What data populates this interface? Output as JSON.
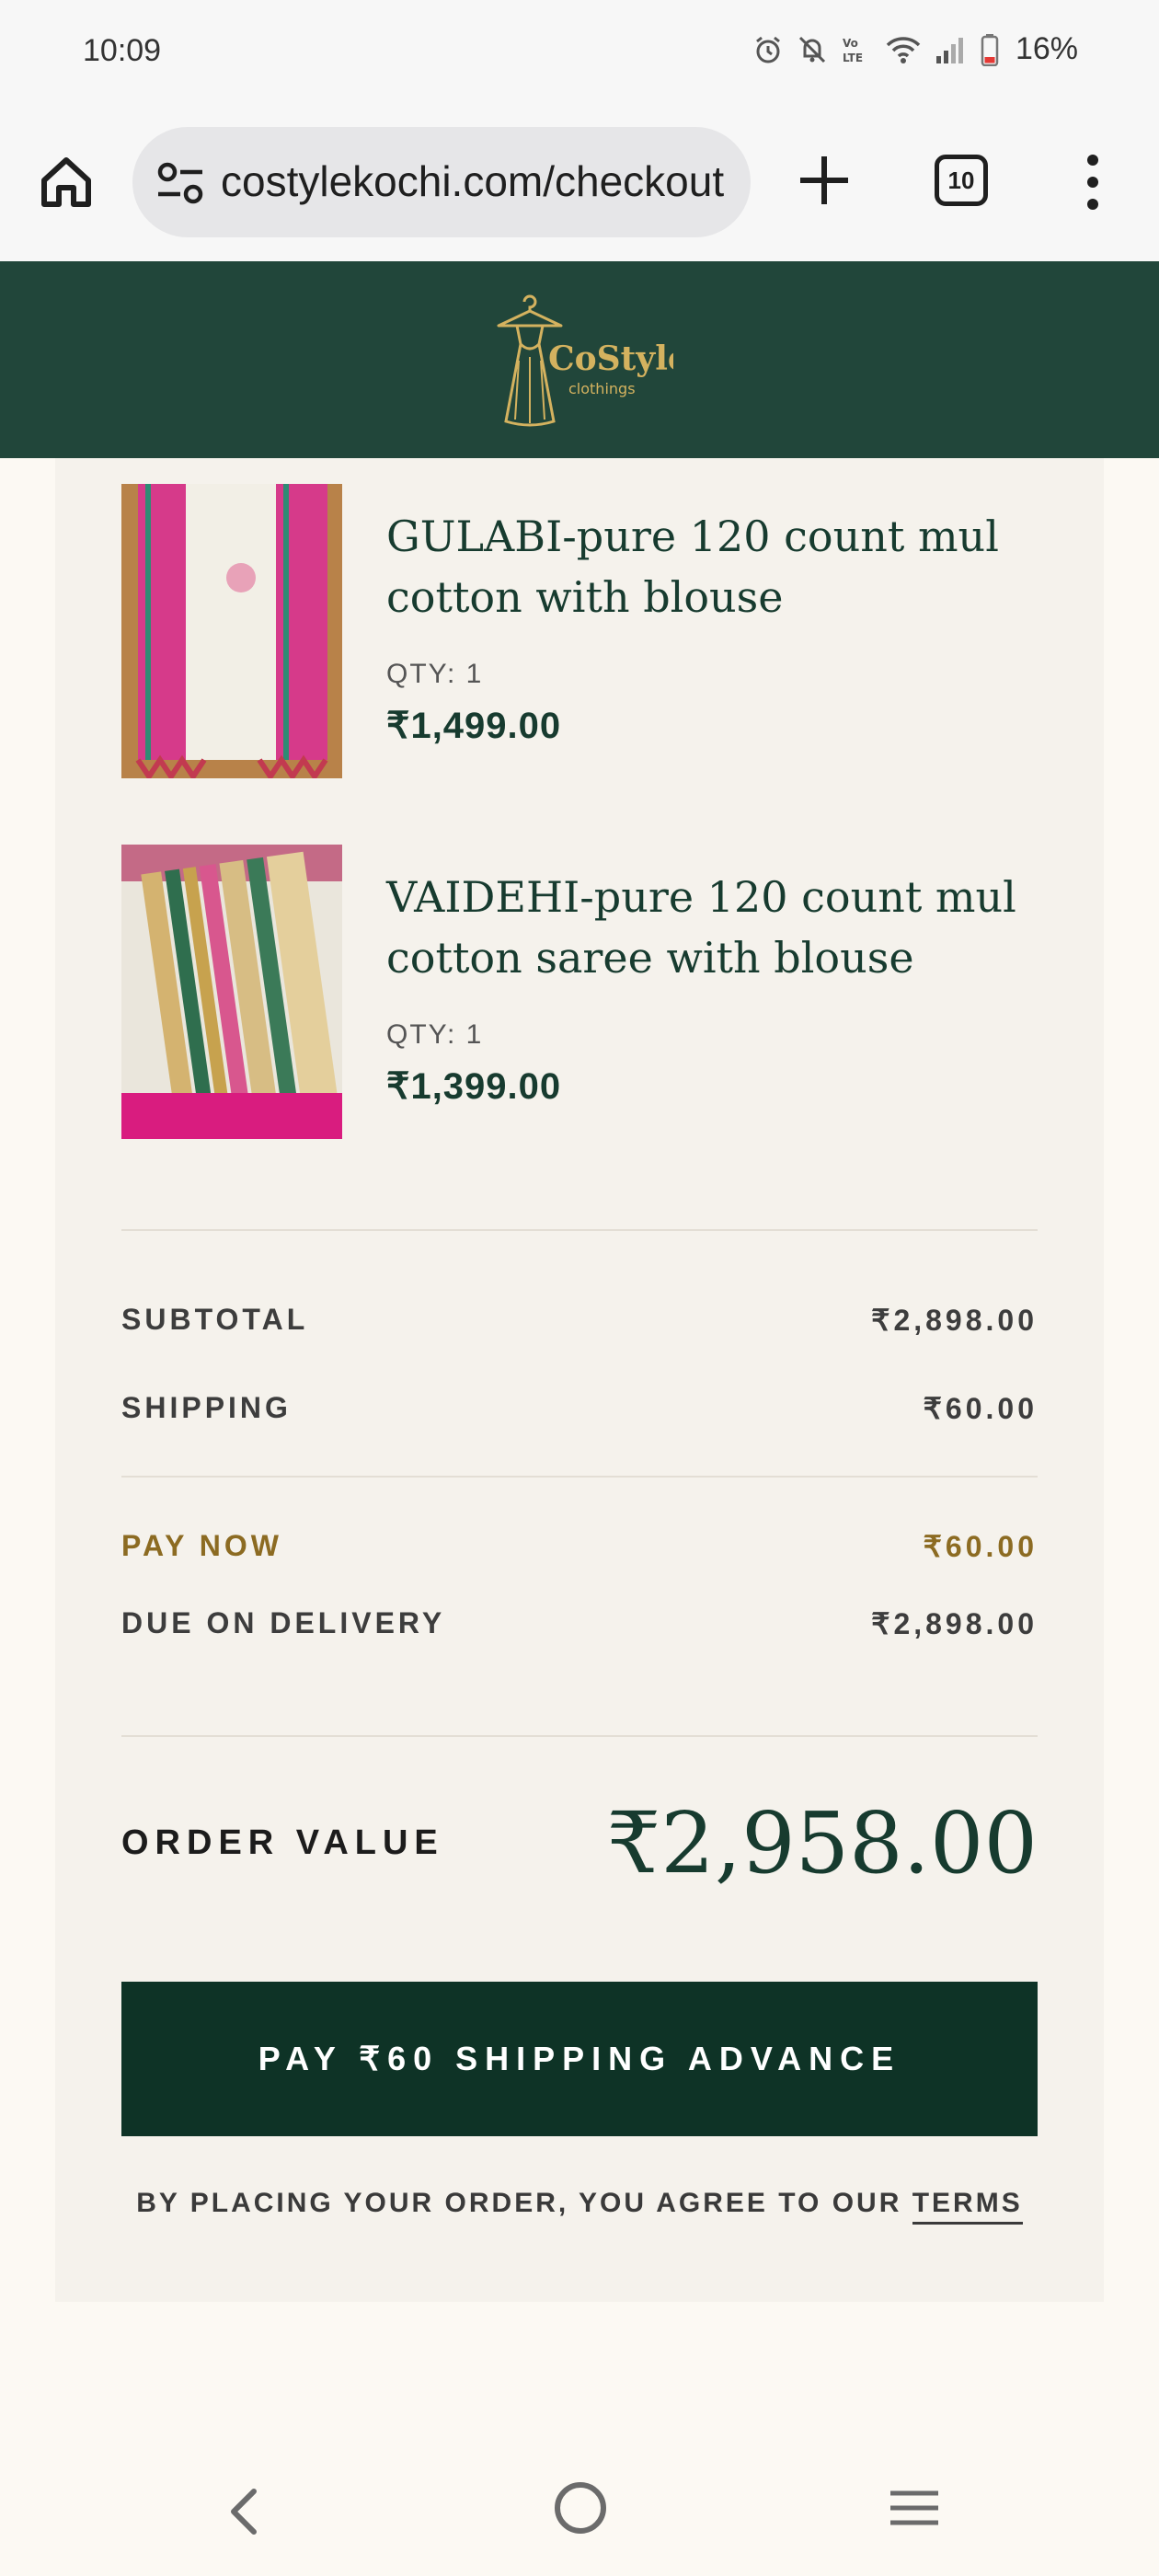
{
  "status_bar": {
    "time": "10:09",
    "battery": "16%",
    "icons": [
      "alarm-icon",
      "mute-icon",
      "volte-icon",
      "wifi-icon",
      "signal-icon",
      "battery-icon"
    ]
  },
  "browser": {
    "url": "costylekochi.com/checkout",
    "tab_count": "10",
    "icons": [
      "home-icon",
      "tune-icon",
      "plus-icon",
      "more-vert-icon"
    ]
  },
  "header": {
    "brand_name": "CoStyle",
    "brand_tagline": "clothings"
  },
  "cart": {
    "items": [
      {
        "name": "GULABI-pure 120 count mul cotton with blouse",
        "qty": "QTY: 1",
        "price": "₹1,499.00"
      },
      {
        "name": "VAIDEHI-pure 120 count mul cotton saree with blouse",
        "qty": "QTY: 1",
        "price": "₹1,399.00"
      }
    ]
  },
  "summary": {
    "subtotal_label": "SUBTOTAL",
    "subtotal_value": "₹2,898.00",
    "shipping_label": "SHIPPING",
    "shipping_value": "₹60.00",
    "pay_now_label": "PAY NOW",
    "pay_now_value": "₹60.00",
    "due_label": "DUE ON DELIVERY",
    "due_value": "₹2,898.00",
    "order_value_label": "ORDER VALUE",
    "order_value": "₹2,958.00"
  },
  "actions": {
    "pay_button": "PAY ₹60 SHIPPING ADVANCE",
    "terms_text": "BY PLACING YOUR ORDER, YOU AGREE TO OUR ",
    "terms_link": "TERMS"
  },
  "colors": {
    "header_bg": "#21463a",
    "accent_gold": "#8c6b22",
    "button_bg": "#0e3326"
  }
}
